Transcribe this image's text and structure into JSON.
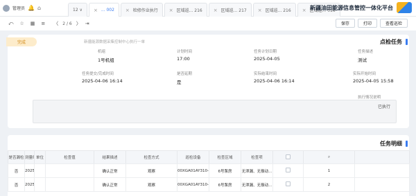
{
  "header": {
    "user": "管理员",
    "brand_title": "新疆油田能源信息管控一体化平台",
    "tabs": [
      {
        "label": "12 ∨",
        "close": ""
      },
      {
        "label": "... 002",
        "close": "×",
        "active": true
      },
      {
        "label": "检修作业执行",
        "close": "×"
      },
      {
        "label": "区域巡... 216",
        "close": "×"
      },
      {
        "label": "区域巡... 217",
        "close": "×"
      },
      {
        "label": "区域巡... 216",
        "close": "×"
      },
      {
        "label": "区域巡... 016",
        "close": "×"
      }
    ]
  },
  "toolbar": {
    "pager": "2 / 6",
    "buttons": [
      "保存",
      "打印",
      "查看巡检"
    ]
  },
  "task": {
    "title": "点检任务",
    "note": "新疆能源数据采集控制中心执行一单",
    "status": "完成",
    "fields": [
      {
        "label": "任务描述",
        "value": "测试"
      },
      {
        "label": "任务计划日期",
        "value": "2025-04-05"
      },
      {
        "label": "计划时间",
        "value": "17:00"
      },
      {
        "label": "机组",
        "value": "1号机组"
      },
      {
        "label": "实际开始时间",
        "value": "2025-04-05 15:58"
      },
      {
        "label": "实际结束时间",
        "value": "2025-04-06 16:14"
      },
      {
        "label": "是否延期",
        "value": "是"
      },
      {
        "label": "任务提交/完成时间",
        "value": "2025-04-06 16:14"
      }
    ],
    "remark_label": "执行情况说明",
    "remark_text": "已执行"
  },
  "detail": {
    "title": "任务明细",
    "columns": [
      "",
      "",
      "检查项",
      "检查区域",
      "巡检设备",
      "检查方式",
      "结果描述",
      "检查值",
      "单位",
      "测量时间",
      "是否漏检"
    ],
    "rows": [
      {
        "no": "1",
        "item": "无泄漏、无振动...",
        "region": "6号泵房",
        "device": "00XGA01AY310-...",
        "method": "观察",
        "result": "确认正常",
        "value": "",
        "unit": "",
        "time": "2025-04-06 15:58:28",
        "missed": "否"
      },
      {
        "no": "2",
        "item": "无泄漏、无振动...",
        "region": "6号泵房",
        "device": "00XGA01AY310-...",
        "method": "观察",
        "result": "确认正常",
        "value": "",
        "unit": "",
        "time": "2025-04-06 15:58:28",
        "missed": "否"
      }
    ]
  }
}
